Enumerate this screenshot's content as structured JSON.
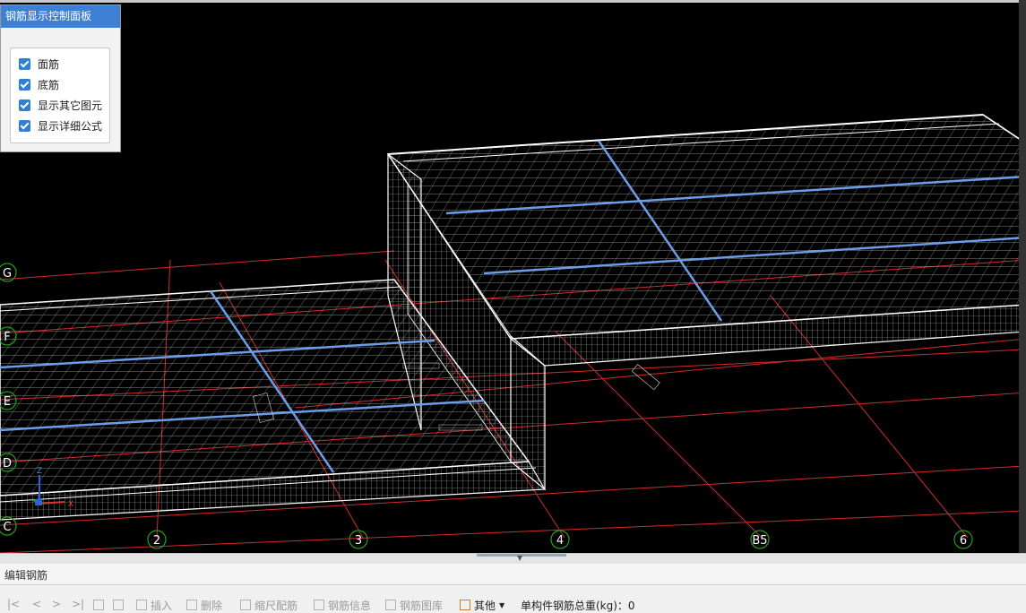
{
  "panel": {
    "title": "钢筋显示控制面板",
    "options": [
      {
        "label": "面筋",
        "checked": true
      },
      {
        "label": "底筋",
        "checked": true
      },
      {
        "label": "显示其它图元",
        "checked": true
      },
      {
        "label": "显示详细公式",
        "checked": true
      }
    ]
  },
  "axes": {
    "rows": [
      "G",
      "F",
      "E",
      "D",
      "C"
    ],
    "cols": [
      "2",
      "3",
      "4",
      "B5",
      "6"
    ],
    "gizmo": {
      "z": "Z",
      "x": "X"
    }
  },
  "edit_panel": {
    "title": "编辑钢筋"
  },
  "toolbar": {
    "nav": [
      "|<",
      "<",
      ">",
      ">|"
    ],
    "insert": "插入",
    "delete": "删除",
    "scale_rebar": "缩尺配筋",
    "rebar_info": "钢筋信息",
    "rebar_library": "钢筋图库",
    "other": "其他",
    "total_weight": "单构件钢筋总重(kg)：0"
  },
  "colors": {
    "grid": "#d42a2a",
    "mesh": "#ffffff",
    "rebar_highlight": "#6c9ee6",
    "axis_marker": "#1fa31f",
    "panel_title_bg": "#3c7fd4",
    "checkbox": "#2f7fd6"
  }
}
